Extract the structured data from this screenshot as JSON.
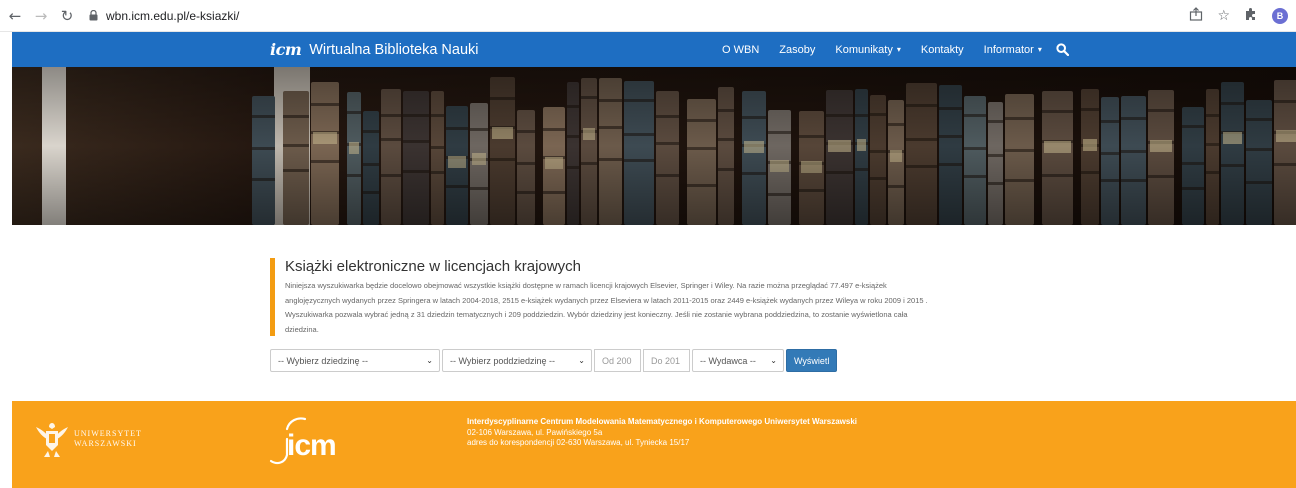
{
  "browser": {
    "url": "wbn.icm.edu.pl/e-ksiazki/",
    "back_icon": "back-arrow-icon",
    "forward_icon": "forward-arrow-icon",
    "reload_icon": "reload-icon",
    "profile_initial": "B"
  },
  "nav": {
    "logo_mark": "icm",
    "site_title": "Wirtualna Biblioteka Nauki",
    "items": [
      {
        "label": "O WBN",
        "dropdown": false
      },
      {
        "label": "Zasoby",
        "dropdown": false
      },
      {
        "label": "Komunikaty",
        "dropdown": true
      },
      {
        "label": "Kontakty",
        "dropdown": false
      },
      {
        "label": "Informator",
        "dropdown": true
      }
    ],
    "caret": "▾"
  },
  "main": {
    "heading": "Książki elektroniczne w licencjach krajowych",
    "description_lines": [
      "Niniejsza wyszukiwarka będzie docelowo obejmować wszystkie książki dostępne w ramach licencji krajowych Elsevier, Springer i Wiley. Na razie można przeglądać 77.497 e-książek",
      "anglojęzycznych wydanych przez Springera w latach 2004-2018, 2515 e-książek wydanych przez Elseviera w latach 2011-2015 oraz 2449 e-książek wydanych przez Wileya w roku 2009 i 2015 .",
      "Wyszukiwarka pozwala wybrać jedną z 31 dziedzin tematycznych i 209 poddziedzin. Wybór dziedziny jest konieczny. Jeśli nie zostanie wybrana poddziedzina, to zostanie wyświetlona cała",
      "dziedzina."
    ],
    "filters": {
      "domain_select": "-- Wybierz dziedzinę --",
      "subdomain_select": "-- Wybierz poddziedzinę --",
      "from_placeholder": "Od 200",
      "to_placeholder": "Do 201",
      "publisher_select": "-- Wydawca --",
      "submit": "Wyświetl",
      "chevron": "⌄"
    }
  },
  "footer": {
    "university_line1": "UNIWERSYTET",
    "university_line2": "WARSZAWSKI",
    "icm_logo": "icm",
    "institute_name": "Interdyscyplinarne Centrum Modelowania Matematycznego i Komputerowego Uniwersytet Warszawski",
    "address": "02-106 Warszawa, ul. Pawińskiego 5a",
    "correspondence": "adres do korespondencji 02-630 Warszawa, ul. Tyniecka 15/17"
  },
  "colors": {
    "nav_bg": "#1e6ec2",
    "accent": "#f39c12",
    "footer_bg": "#f9a21b",
    "button_bg": "#337ab7"
  }
}
